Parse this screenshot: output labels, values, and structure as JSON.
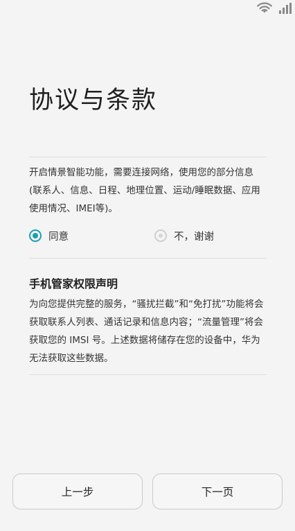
{
  "status_bar": {
    "wifi_icon": "wifi-icon",
    "signal_icon": "signal-icon"
  },
  "title": "协议与条款",
  "smart_features_text": "开启情景智能功能，需要连接网络，使用您的部分信息 (联系人、信息、日程、地理位置、运动/睡眠数据、应用使用情况、IMEI等)。",
  "options": {
    "agree_label": "同意",
    "agree_selected": true,
    "decline_label": "不，谢谢",
    "decline_selected": false
  },
  "permissions": {
    "heading": "手机管家权限声明",
    "body": "为向您提供完整的服务，“骚扰拦截”和“免打扰”功能将会获取联系人列表、通话记录和信息内容；“流量管理”将会获取您的 IMSI 号。上述数据将储存在您的设备中，华为无法获取这些数据。"
  },
  "buttons": {
    "prev_label": "上一步",
    "next_label": "下一页"
  },
  "colors": {
    "accent": "#1a9fb1",
    "background": "#f4f4f4"
  }
}
